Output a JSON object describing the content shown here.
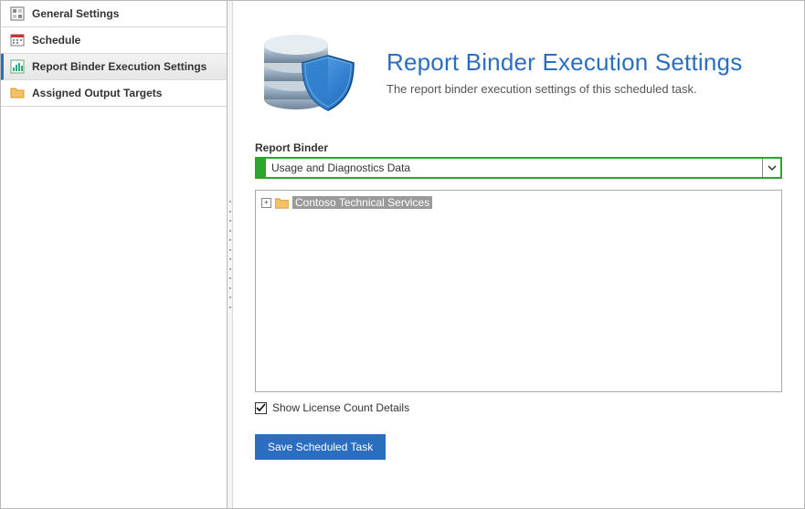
{
  "sidebar": {
    "items": [
      {
        "label": "General Settings"
      },
      {
        "label": "Schedule"
      },
      {
        "label": "Report Binder Execution Settings"
      },
      {
        "label": "Assigned Output Targets"
      }
    ],
    "selected_index": 2
  },
  "header": {
    "title": "Report Binder Execution Settings",
    "subtitle": "The report binder execution settings of this scheduled task."
  },
  "report_binder": {
    "label": "Report Binder",
    "selected": "Usage and Diagnostics Data"
  },
  "tree": {
    "root": {
      "label": "Contoso Technical Services",
      "expanded": false
    }
  },
  "license_checkbox": {
    "label": "Show License Count Details",
    "checked": true
  },
  "save_button": {
    "label": "Save Scheduled Task"
  }
}
